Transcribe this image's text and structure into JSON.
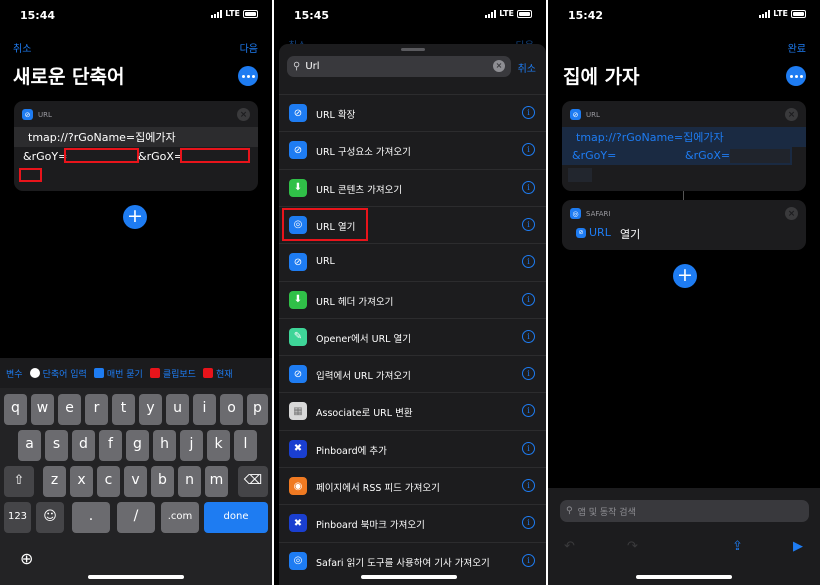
{
  "colors": {
    "accent": "#1e7cf2",
    "red_highlight": "#e8141b"
  },
  "panel1": {
    "time": "15:44",
    "carrier": "LTE",
    "cancel": "취소",
    "next": "다음",
    "title": "새로운 단축어",
    "card": {
      "header": "URL",
      "line1": "tmap://?rGoName=집에가자",
      "line2a": "&rGoY=",
      "line2b": "&rGoX="
    },
    "suggestions": [
      "변수",
      "단축어 입력",
      "매번 묻기",
      "클립보드",
      "현재"
    ],
    "keys": {
      "row1": [
        "q",
        "w",
        "e",
        "r",
        "t",
        "y",
        "u",
        "i",
        "o",
        "p"
      ],
      "row2": [
        "a",
        "s",
        "d",
        "f",
        "g",
        "h",
        "j",
        "k",
        "l"
      ],
      "row3": [
        "z",
        "x",
        "c",
        "v",
        "b",
        "n",
        "m"
      ],
      "num": "123",
      "dot": ".",
      "slash": "/",
      "com": ".com",
      "done": "done"
    }
  },
  "panel2": {
    "time": "15:45",
    "carrier": "LTE",
    "behind_left": "취소",
    "behind_right": "다음",
    "search_value": "Url",
    "cancel": "취소",
    "results": [
      {
        "label": "URL 확장",
        "icon": "link-icon",
        "color": "#1e7cf2"
      },
      {
        "label": "URL 구성요소 가져오기",
        "icon": "link-icon",
        "color": "#1e7cf2"
      },
      {
        "label": "URL 콘텐츠 가져오기",
        "icon": "download-icon",
        "color": "#30c048"
      },
      {
        "label": "URL 열기",
        "icon": "safari-icon",
        "color": "#1e7cf2"
      },
      {
        "label": "URL",
        "icon": "link-icon",
        "color": "#1e7cf2"
      },
      {
        "label": "URL 헤더 가져오기",
        "icon": "download-icon",
        "color": "#30c048"
      },
      {
        "label": "Opener에서 URL 열기",
        "icon": "opener-icon",
        "color": "#3ed598"
      },
      {
        "label": "입력에서 URL 가져오기",
        "icon": "link-icon",
        "color": "#1e7cf2"
      },
      {
        "label": "Associate로 URL 변환",
        "icon": "associate-icon",
        "color": "#d8d8d8"
      },
      {
        "label": "Pinboard에 추가",
        "icon": "pin-icon",
        "color": "#1a3fd0"
      },
      {
        "label": "페이지에서 RSS 피드 가져오기",
        "icon": "rss-icon",
        "color": "#f07a22"
      },
      {
        "label": "Pinboard 북마크 가져오기",
        "icon": "pin-icon",
        "color": "#1a3fd0"
      },
      {
        "label": "Safari 읽기 도구를 사용하여 기사 가져오기",
        "icon": "safari-icon",
        "color": "#1e7cf2"
      }
    ]
  },
  "panel3": {
    "time": "15:42",
    "carrier": "LTE",
    "done": "완료",
    "title": "집에 가자",
    "url_card": {
      "header": "URL",
      "line1": "tmap://?rGoName=집에가자",
      "line2a": "&rGoY=",
      "line2b": "&rGoX="
    },
    "safari_card": {
      "header": "SAFARI",
      "token": "URL",
      "action": "열기"
    },
    "search_placeholder": "앱 및 동작 검색"
  }
}
